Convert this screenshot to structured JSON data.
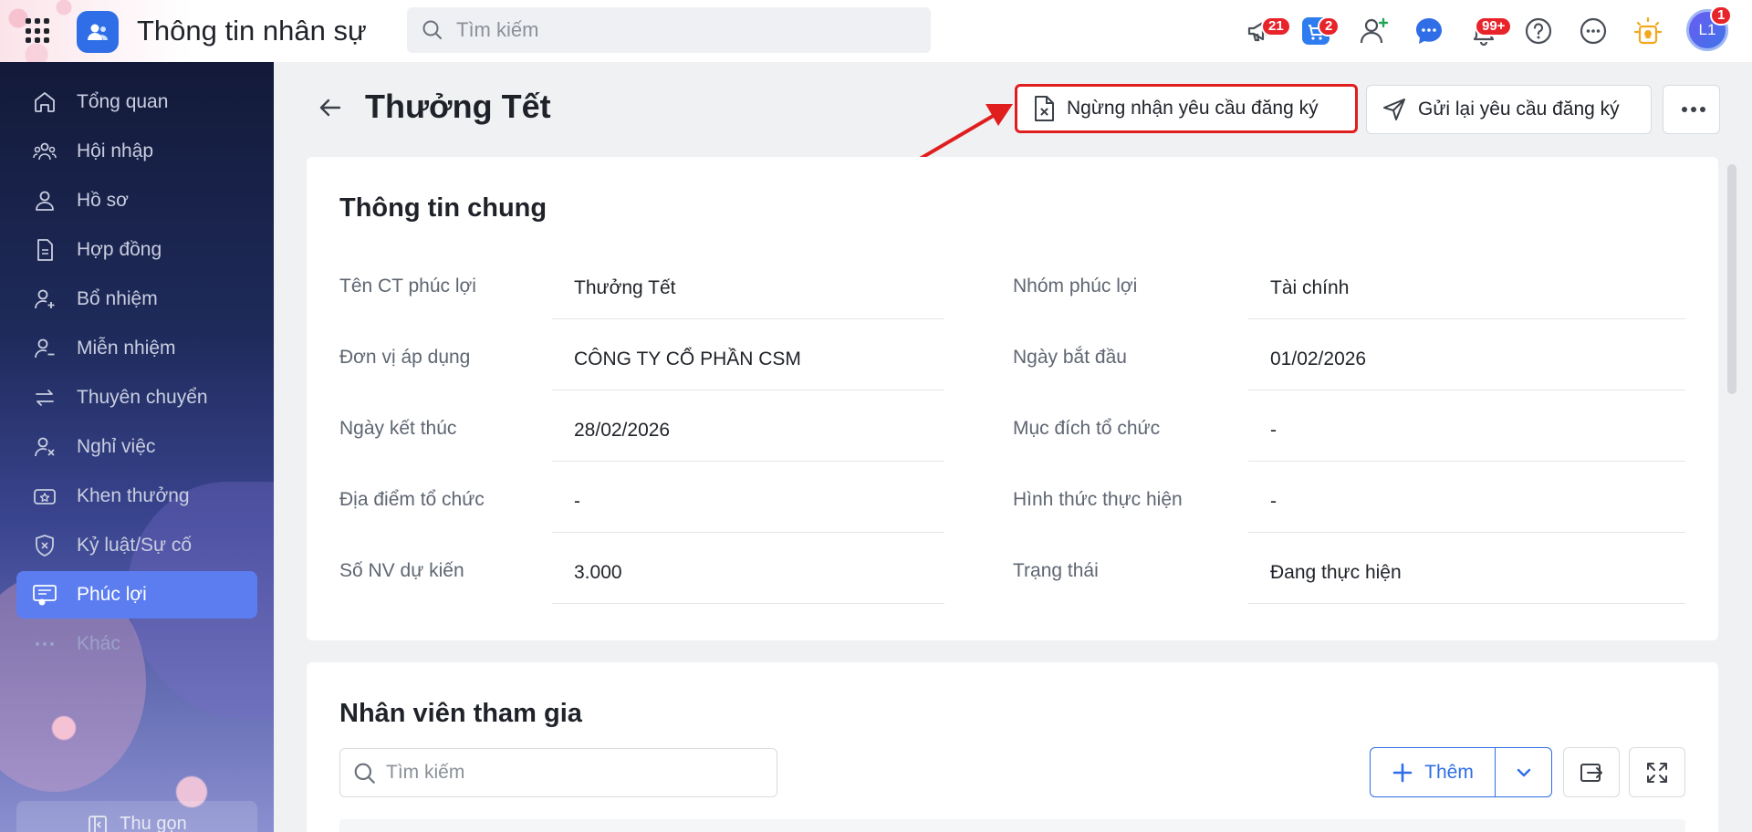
{
  "app": {
    "title": "Thông tin nhân sự",
    "search_placeholder": "Tìm kiếm",
    "brand_color": "#2f6ee6"
  },
  "topbar": {
    "icons": [
      {
        "name": "megaphone-icon",
        "badge": "21"
      },
      {
        "name": "cart-icon",
        "badge": "2"
      },
      {
        "name": "add-user-icon",
        "badge": ""
      },
      {
        "name": "chat-icon",
        "badge": ""
      },
      {
        "name": "bell-icon",
        "badge": "99+"
      },
      {
        "name": "help-icon",
        "badge": ""
      },
      {
        "name": "more-icon",
        "badge": ""
      },
      {
        "name": "idea-icon",
        "badge": ""
      }
    ],
    "avatar_initials": "L1",
    "avatar_badge": "1"
  },
  "sidebar": {
    "items": [
      {
        "label": "Tổng quan",
        "icon": "home-icon"
      },
      {
        "label": "Hội nhập",
        "icon": "team-icon"
      },
      {
        "label": "Hồ sơ",
        "icon": "user-icon"
      },
      {
        "label": "Hợp đồng",
        "icon": "document-icon"
      },
      {
        "label": "Bổ nhiệm",
        "icon": "user-plus-icon"
      },
      {
        "label": "Miễn nhiệm",
        "icon": "user-minus-icon"
      },
      {
        "label": "Thuyên chuyển",
        "icon": "transfer-icon"
      },
      {
        "label": "Nghỉ việc",
        "icon": "user-x-icon"
      },
      {
        "label": "Khen thưởng",
        "icon": "award-icon"
      },
      {
        "label": "Kỷ luật/Sự cố",
        "icon": "shield-x-icon"
      },
      {
        "label": "Phúc lợi",
        "icon": "benefit-icon",
        "active": true
      },
      {
        "label": "Khác",
        "icon": "dots-icon"
      }
    ],
    "collapse_label": "Thu gọn"
  },
  "header": {
    "title": "Thưởng Tết",
    "stop_button": "Ngừng nhận yêu cầu đăng ký",
    "resend_button": "Gửi lại yêu cầu đăng ký"
  },
  "general": {
    "title": "Thông tin chung",
    "left": [
      {
        "label": "Tên CT phúc lợi",
        "value": "Thưởng Tết"
      },
      {
        "label": "Đơn vị áp dụng",
        "value": "CÔNG TY CỔ PHẦN CSM"
      },
      {
        "label": "Ngày kết thúc",
        "value": "28/02/2026"
      },
      {
        "label": "Địa điểm tổ chức",
        "value": "-"
      },
      {
        "label": "Số NV dự kiến",
        "value": "3.000"
      }
    ],
    "right": [
      {
        "label": "Nhóm phúc lợi",
        "value": "Tài chính"
      },
      {
        "label": "Ngày bắt đầu",
        "value": "01/02/2026"
      },
      {
        "label": "Mục đích tổ chức",
        "value": "-"
      },
      {
        "label": "Hình thức thực hiện",
        "value": "-"
      },
      {
        "label": "Trạng thái",
        "value": "Đang thực hiện"
      }
    ]
  },
  "participants": {
    "title": "Nhân viên tham gia",
    "search_placeholder": "Tìm kiếm",
    "add_button": "Thêm"
  },
  "annotation": {
    "color": "#e01e1e"
  }
}
